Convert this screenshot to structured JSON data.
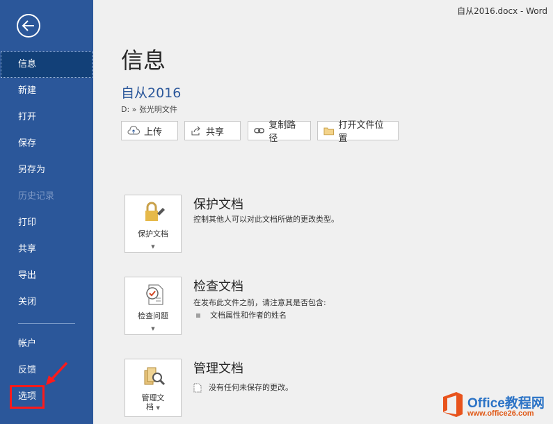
{
  "window": {
    "title": "自从2016.docx  -  Word"
  },
  "sidebar": {
    "items": [
      {
        "label": "信息"
      },
      {
        "label": "新建"
      },
      {
        "label": "打开"
      },
      {
        "label": "保存"
      },
      {
        "label": "另存为"
      },
      {
        "label": "历史记录"
      },
      {
        "label": "打印"
      },
      {
        "label": "共享"
      },
      {
        "label": "导出"
      },
      {
        "label": "关闭"
      },
      {
        "label": "帐户"
      },
      {
        "label": "反馈"
      },
      {
        "label": "选项"
      }
    ],
    "active_index": 0,
    "disabled_index": 5
  },
  "main": {
    "title": "信息",
    "doc_name": "自从2016",
    "doc_path": "D: » 张光明文件",
    "actions": [
      {
        "label": "上传",
        "icon": "upload-icon"
      },
      {
        "label": "共享",
        "icon": "share-icon"
      },
      {
        "label": "复制路径",
        "icon": "link-icon"
      },
      {
        "label": "打开文件位置",
        "icon": "folder-icon"
      }
    ],
    "sections": [
      {
        "card_label": "保护文档",
        "heading": "保护文档",
        "desc": "控制其他人可以对此文档所做的更改类型。",
        "icon": "lock-key-icon"
      },
      {
        "card_label": "检查问题",
        "heading": "检查文档",
        "desc": "在发布此文件之前，请注意其是否包含:",
        "bullet": "文档属性和作者的姓名",
        "icon": "inspect-document-icon"
      },
      {
        "card_label_line1": "管理文",
        "card_label_line2": "档",
        "heading": "管理文档",
        "desc": "没有任何未保存的更改。",
        "icon": "manage-document-icon"
      }
    ]
  },
  "watermark": {
    "title": "Office教程网",
    "url": "www.office26.com"
  },
  "colors": {
    "sidebar": "#2b579a",
    "accent": "#2b579a",
    "highlight": "#ff1a1a"
  }
}
